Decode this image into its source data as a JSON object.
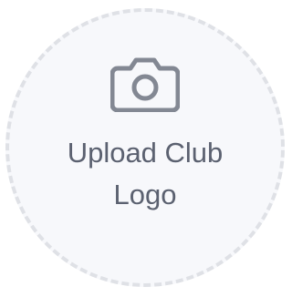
{
  "upload": {
    "label": "Upload Club Logo",
    "icon": "camera-icon",
    "colors": {
      "background": "#f7f8fb",
      "border": "#dfe1e6",
      "icon": "#838893",
      "text": "#5b6170"
    }
  }
}
